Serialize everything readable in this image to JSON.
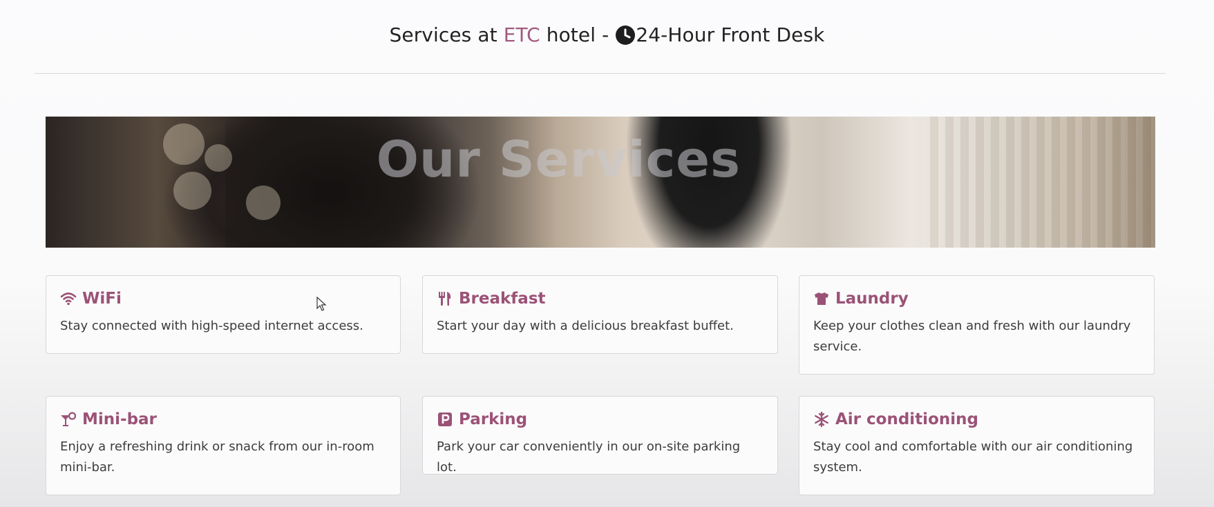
{
  "header": {
    "prefix": "Services at ",
    "brand": "ETC",
    "middle": " hotel - ",
    "front_desk": "24-Hour Front Desk",
    "clock_icon": "clock-icon"
  },
  "banner": {
    "title": "Our Services"
  },
  "colors": {
    "accent": "#a15a7e",
    "card_title": "#9b5277",
    "text": "#3c3c3c"
  },
  "services": [
    {
      "icon": "wifi-icon",
      "title": "WiFi",
      "desc": "Stay connected with high-speed internet access."
    },
    {
      "icon": "utensils-icon",
      "title": "Breakfast",
      "desc": "Start your day with a delicious breakfast buffet."
    },
    {
      "icon": "shirt-icon",
      "title": "Laundry",
      "desc": "Keep your clothes clean and fresh with our laundry service."
    },
    {
      "icon": "cocktail-icon",
      "title": "Mini-bar",
      "desc": "Enjoy a refreshing drink or snack from our in-room mini-bar."
    },
    {
      "icon": "parking-icon",
      "title": "Parking",
      "desc": "Park your car conveniently in our on-site parking lot."
    },
    {
      "icon": "snowflake-icon",
      "title": "Air conditioning",
      "desc": "Stay cool and comfortable with our air conditioning system."
    }
  ]
}
